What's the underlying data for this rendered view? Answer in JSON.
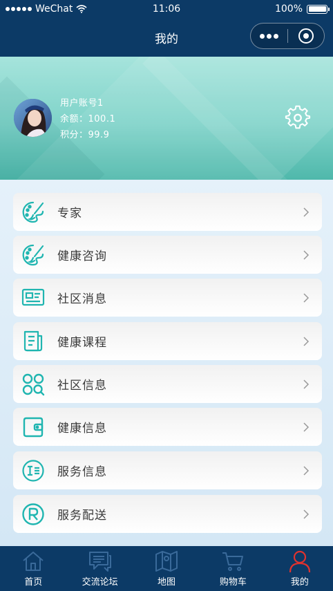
{
  "status_bar": {
    "carrier": "WeChat",
    "time": "11:06",
    "battery": "100%"
  },
  "nav": {
    "title": "我的"
  },
  "user": {
    "account": "用户账号1",
    "balance_text": "余额：100.1",
    "points_text": "积分：99.9"
  },
  "menu": [
    {
      "label": "专家",
      "icon": "palette-icon"
    },
    {
      "label": "健康咨询",
      "icon": "palette-icon"
    },
    {
      "label": "社区消息",
      "icon": "id-card-icon"
    },
    {
      "label": "健康课程",
      "icon": "document-icon"
    },
    {
      "label": "社区信息",
      "icon": "grid-search-icon"
    },
    {
      "label": "健康信息",
      "icon": "wallet-icon"
    },
    {
      "label": "服务信息",
      "icon": "text-circle-icon"
    },
    {
      "label": "服务配送",
      "icon": "registered-icon"
    }
  ],
  "tabs": [
    {
      "label": "首页",
      "icon": "home-icon"
    },
    {
      "label": "交流论坛",
      "icon": "chat-icon"
    },
    {
      "label": "地图",
      "icon": "map-icon"
    },
    {
      "label": "购物车",
      "icon": "cart-icon"
    },
    {
      "label": "我的",
      "icon": "person-icon",
      "active": true
    }
  ],
  "colors": {
    "navy": "#0c3a66",
    "teal_icon": "#1fb5b0",
    "tab_inactive": "#3a6a9a",
    "tab_active": "#e0322e"
  }
}
